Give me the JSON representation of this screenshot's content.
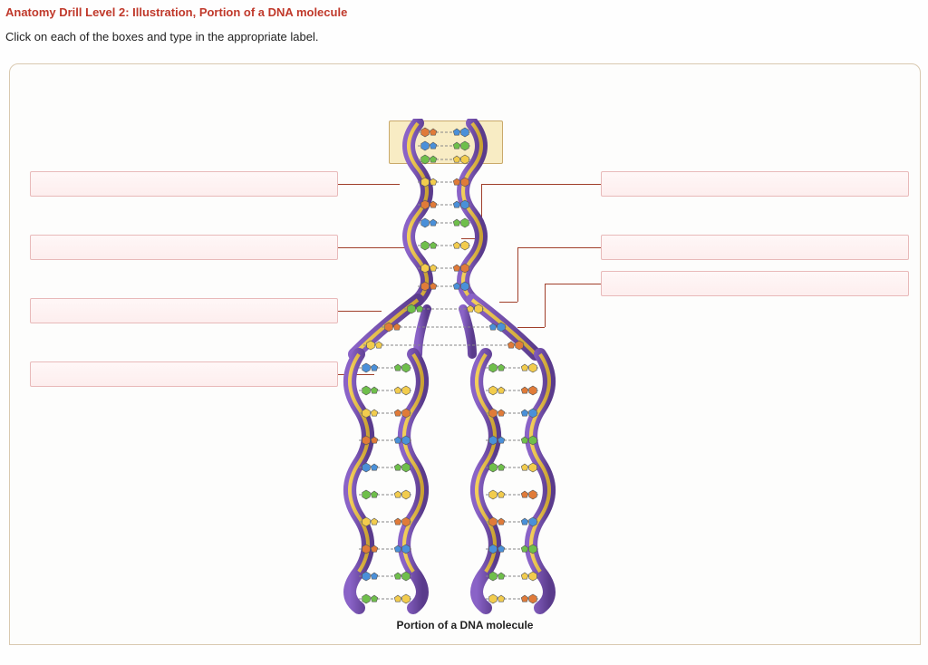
{
  "title": "Anatomy Drill Level 2: Illustration, Portion of a DNA molecule",
  "instruction": "Click on each of the boxes and type in the appropriate label.",
  "caption": "Portion of a DNA molecule",
  "labels": {
    "left": [
      {
        "id": "left-1",
        "value": ""
      },
      {
        "id": "left-2",
        "value": ""
      },
      {
        "id": "left-3",
        "value": ""
      },
      {
        "id": "left-4",
        "value": ""
      }
    ],
    "right": [
      {
        "id": "right-1",
        "value": ""
      },
      {
        "id": "right-2",
        "value": ""
      },
      {
        "id": "right-3",
        "value": ""
      }
    ]
  },
  "colors": {
    "backbone": "#6a3fa0",
    "backbone2": "#d9a72e",
    "adenine": "#e07b39",
    "thymine": "#4a90d9",
    "guanine": "#6fbf4b",
    "cytosine": "#f2cc4d",
    "hbond": "#888"
  }
}
